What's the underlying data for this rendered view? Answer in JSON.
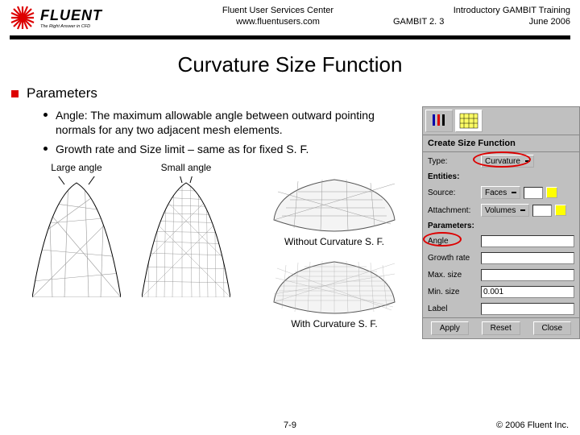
{
  "header": {
    "logo_main": "FLUENT",
    "logo_tag": "The Right Answer in CFD",
    "center_line1": "Fluent User Services Center",
    "center_line2": "www.fluentusers.com",
    "right_line1": "Introductory GAMBIT Training",
    "right_line2a": "GAMBIT 2. 3",
    "right_line2b": "June 2006"
  },
  "title": "Curvature Size Function",
  "parameters": {
    "heading": "Parameters",
    "bullet1": "Angle: The maximum allowable angle between outward pointing normals for any two adjacent mesh elements.",
    "bullet2": "Growth rate and Size limit – same as for fixed S. F."
  },
  "fig": {
    "large_label": "Large angle",
    "small_label": "Small angle",
    "without_caption": "Without Curvature S. F.",
    "with_caption": "With Curvature S. F."
  },
  "dialog": {
    "title": "Create Size Function",
    "type_label": "Type:",
    "type_value": "Curvature",
    "entities_label": "Entities:",
    "source_label": "Source:",
    "source_value": "Faces",
    "attachment_label": "Attachment:",
    "attachment_value": "Volumes",
    "parameters_label": "Parameters:",
    "angle_label": "Angle",
    "growth_label": "Growth rate",
    "max_label": "Max. size",
    "min_label": "Min. size",
    "min_value": "0.001",
    "label_label": "Label",
    "apply": "Apply",
    "reset": "Reset",
    "close": "Close"
  },
  "footer": {
    "page": "7-9",
    "copyright": "© 2006 Fluent Inc."
  }
}
